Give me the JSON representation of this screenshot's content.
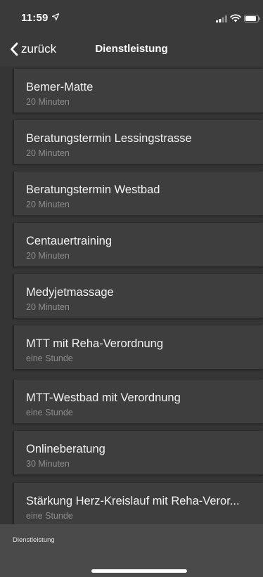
{
  "status_bar": {
    "time": "11:59",
    "location_icon": "location-arrow-icon",
    "signal_icon": "cellular-signal-icon",
    "wifi_icon": "wifi-icon",
    "battery_icon": "battery-icon"
  },
  "nav": {
    "back_label": "zurück",
    "back_icon": "chevron-left-icon",
    "title": "Dienstleistung"
  },
  "services": [
    {
      "title": "Bemer-Matte",
      "duration": "20 Minuten"
    },
    {
      "title": "Beratungstermin Lessingstrasse",
      "duration": "20 Minuten"
    },
    {
      "title": "Beratungstermin Westbad",
      "duration": "20 Minuten"
    },
    {
      "title": "Centauertraining",
      "duration": "20 Minuten"
    },
    {
      "title": "Medyjetmassage",
      "duration": "20 Minuten"
    },
    {
      "title": "MTT mit Reha-Verordnung",
      "duration": "eine Stunde"
    },
    {
      "title": "MTT-Westbad mit Verordnung",
      "duration": "eine Stunde"
    },
    {
      "title": "Onlineberatung",
      "duration": "30 Minuten"
    },
    {
      "title": "Stärkung Herz-Kreislauf mit Reha-Veror...",
      "duration": "eine Stunde"
    }
  ],
  "tab_bar": {
    "label": "Dienstleistung"
  },
  "colors": {
    "background": "#353535",
    "item_background": "#3e3e3e",
    "subtitle": "#8d8d8d",
    "tab_area": "#4a4a4a"
  }
}
